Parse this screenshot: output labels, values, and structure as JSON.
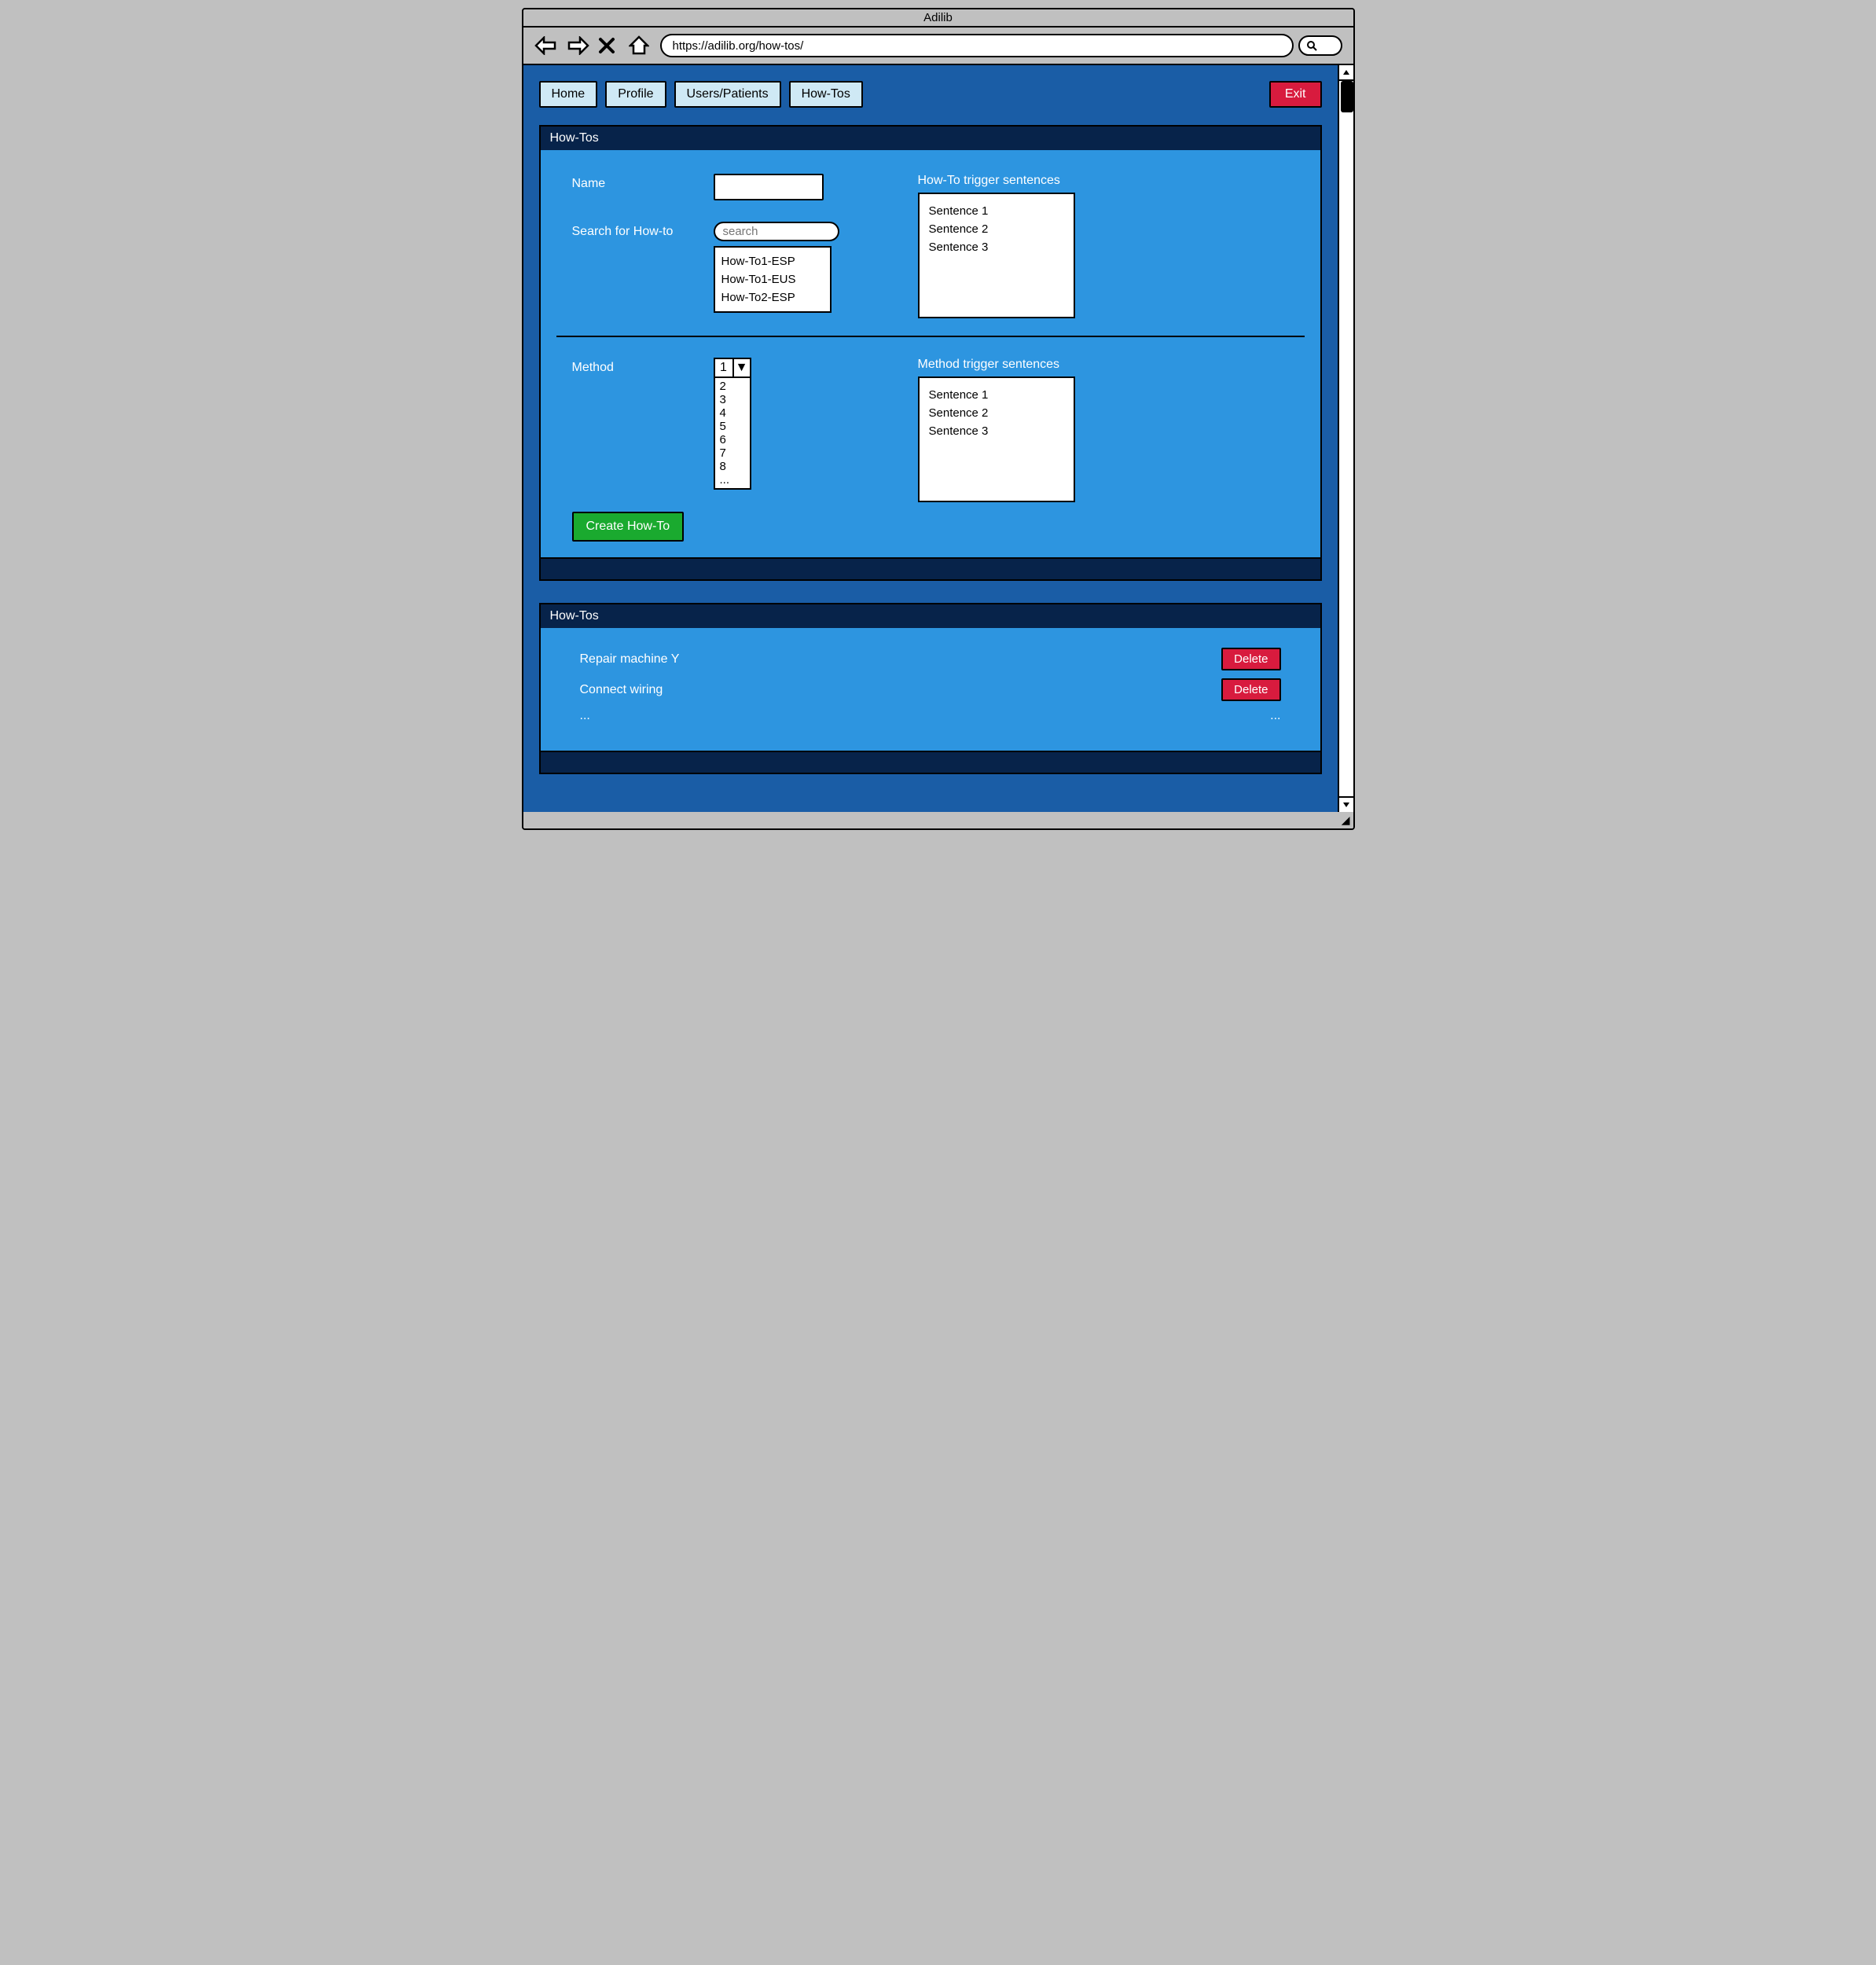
{
  "window": {
    "title": "Adilib",
    "url": "https://adilib.org/how-tos/"
  },
  "nav": {
    "tabs": [
      "Home",
      "Profile",
      "Users/Patients",
      "How-Tos"
    ],
    "exit": "Exit"
  },
  "editor": {
    "title": "How-Tos",
    "name_label": "Name",
    "name_value": "",
    "search_label": "Search for How-to",
    "search_placeholder": "search",
    "search_results": [
      "How-To1-ESP",
      "How-To1-EUS",
      "How-To2-ESP"
    ],
    "howto_trigger_label": "How-To trigger sentences",
    "howto_trigger_items": [
      "Sentence 1",
      "Sentence 2",
      "Sentence 3"
    ],
    "method_label": "Method",
    "method_selected": "1",
    "method_options": [
      "2",
      "3",
      "4",
      "5",
      "6",
      "7",
      "8",
      "..."
    ],
    "method_trigger_label": "Method trigger sentences",
    "method_trigger_items": [
      "Sentence 1",
      "Sentence 2",
      "Sentence 3"
    ],
    "create_label": "Create How-To"
  },
  "list": {
    "title": "How-Tos",
    "items": [
      {
        "name": "Repair machine Y",
        "delete": "Delete"
      },
      {
        "name": "Connect wiring",
        "delete": "Delete"
      },
      {
        "name": "...",
        "delete": "..."
      }
    ]
  }
}
